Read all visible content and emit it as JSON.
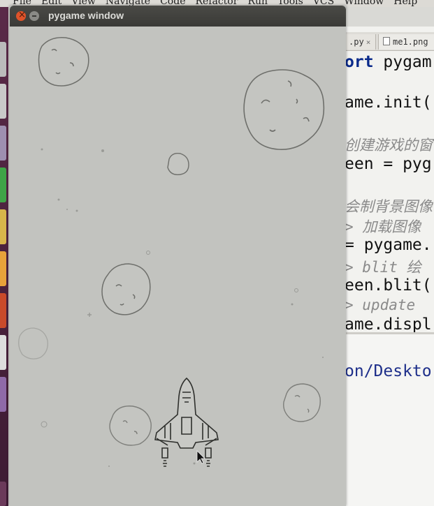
{
  "ide": {
    "menu": [
      "File",
      "Edit",
      "View",
      "Navigate",
      "Code",
      "Refactor",
      "Run",
      "Tools",
      "VCS",
      "Window",
      "Help"
    ],
    "tabs": [
      {
        "label": ".py",
        "close": "×"
      },
      {
        "label": "me1.png"
      }
    ],
    "code_lines": [
      {
        "kw": "ort",
        "rest": " pygam"
      },
      {
        "text": "ame.init("
      },
      {
        "comment": "创建游戏的窗"
      },
      {
        "text": "een = pyg"
      },
      {
        "comment": "会制背景图像"
      },
      {
        "comment": "> 加载图像"
      },
      {
        "text": "= pygame."
      },
      {
        "comment": "> blit 绘"
      },
      {
        "text": "een.blit("
      },
      {
        "comment": "> update"
      },
      {
        "text": "ame.displ"
      }
    ],
    "terminal_path": "on/Deskto"
  },
  "pygame_window": {
    "title": "pygame window"
  },
  "colors": {
    "titlebar": "#3f3f3c",
    "close_button": "#e0532a",
    "game_bg": "#c2c3bf",
    "launcher": "#4a2240"
  }
}
